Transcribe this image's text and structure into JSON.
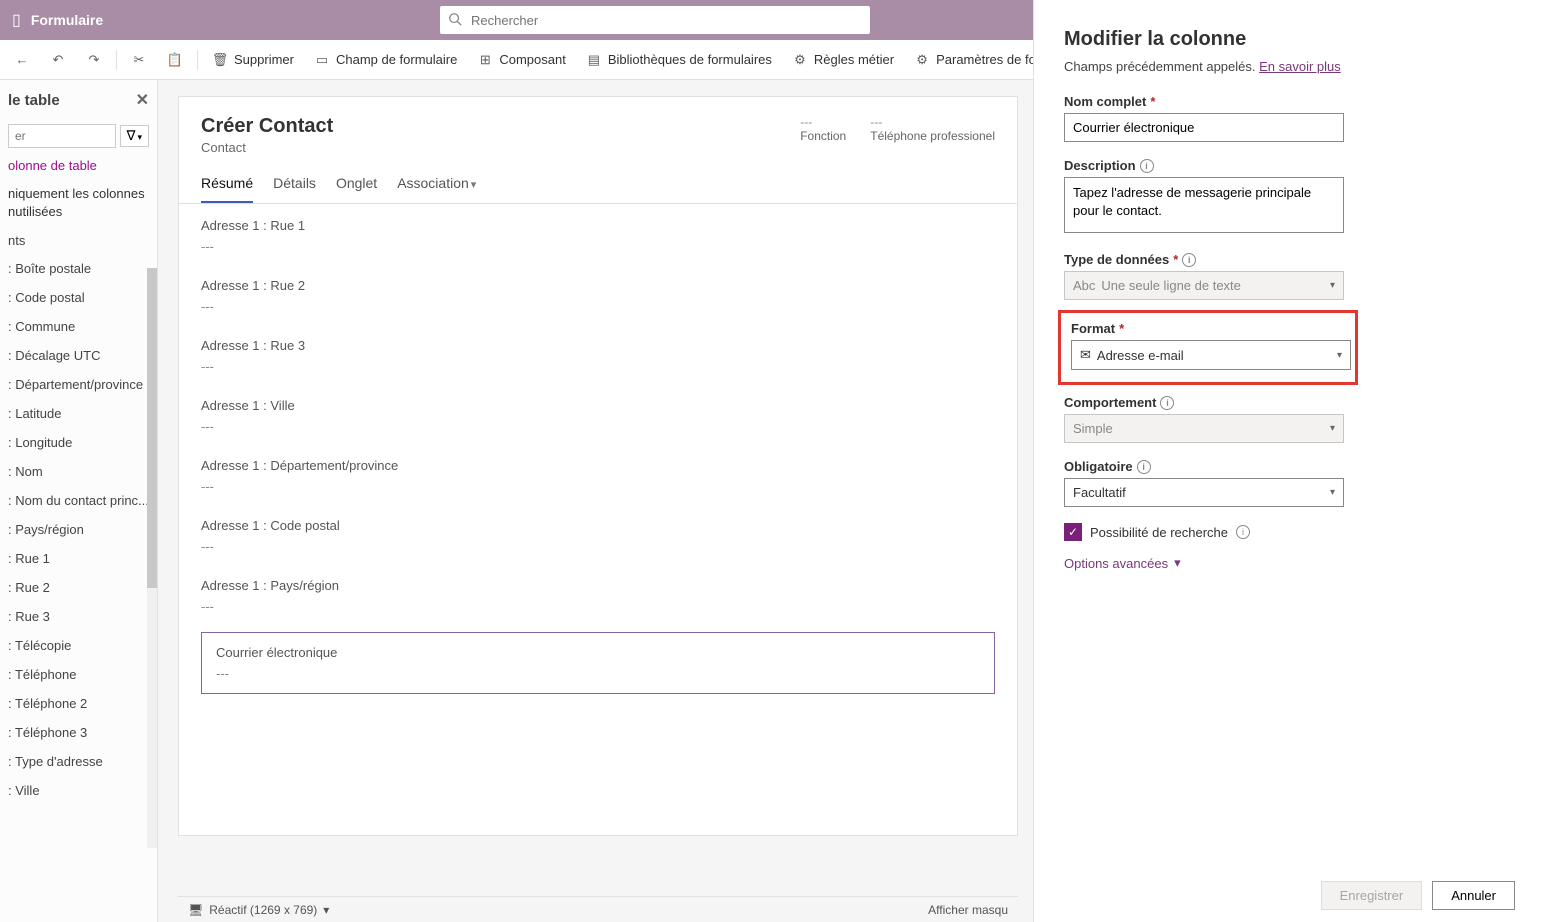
{
  "topbar": {
    "title": "Formulaire",
    "search_placeholder": "Rechercher"
  },
  "cmdbar": {
    "delete": "Supprimer",
    "form_field": "Champ de formulaire",
    "component": "Composant",
    "form_libs": "Bibliothèques de formulaires",
    "business_rules": "Règles métier",
    "form_params": "Paramètres de formulaire"
  },
  "leftpane": {
    "heading": "le table",
    "filter_placeholder": "er",
    "new_column": "olonne de table",
    "show_unused": "niquement les colonnes nutilisées",
    "group": "nts",
    "items": [
      ": Boîte postale",
      ": Code postal",
      ": Commune",
      ": Décalage UTC",
      ": Département/province",
      ": Latitude",
      ": Longitude",
      ": Nom",
      ": Nom du contact princ...",
      ": Pays/région",
      ": Rue 1",
      ": Rue 2",
      ": Rue 3",
      ": Télécopie",
      ": Téléphone",
      ": Téléphone 2",
      ": Téléphone 3",
      ": Type d'adresse",
      ": Ville"
    ]
  },
  "form": {
    "title": "Créer Contact",
    "subtitle": "Contact",
    "meta1_val": "---",
    "meta1_lbl": "Fonction",
    "meta2_val": "---",
    "meta2_lbl": "Téléphone professionel",
    "tabs": [
      "Résumé",
      "Détails",
      "Onglet",
      "Association"
    ],
    "active_tab": 0,
    "fields": [
      {
        "label": "Adresse 1 : Rue 1",
        "value": "---"
      },
      {
        "label": "Adresse 1 : Rue 2",
        "value": "---"
      },
      {
        "label": "Adresse 1 : Rue 3",
        "value": "---"
      },
      {
        "label": "Adresse 1 : Ville",
        "value": "---"
      },
      {
        "label": "Adresse 1 : Département/province",
        "value": "---"
      },
      {
        "label": "Adresse 1 : Code postal",
        "value": "---"
      },
      {
        "label": "Adresse 1 : Pays/région",
        "value": "---"
      },
      {
        "label": "Courrier électronique",
        "value": "---",
        "selected": true
      }
    ]
  },
  "rightpane": {
    "title": "Modifier la colonne",
    "subtitle_prefix": "Champs précédemment appelés. ",
    "subtitle_link": "En savoir plus",
    "name_label": "Nom complet",
    "name_value": "Courrier électronique",
    "desc_label": "Description",
    "desc_value": "Tapez l'adresse de messagerie principale pour le contact.",
    "datatype_label": "Type de données",
    "datatype_value": "Une seule ligne de texte",
    "format_label": "Format",
    "format_value": "Adresse e-mail",
    "behavior_label": "Comportement",
    "behavior_value": "Simple",
    "required_label": "Obligatoire",
    "required_value": "Facultatif",
    "searchable_label": "Possibilité de recherche",
    "advanced_label": "Options avancées",
    "save": "Enregistrer",
    "cancel": "Annuler"
  },
  "status": {
    "reactive": "Réactif (1269 x 769)",
    "show_hidden": "Afficher masqu"
  }
}
